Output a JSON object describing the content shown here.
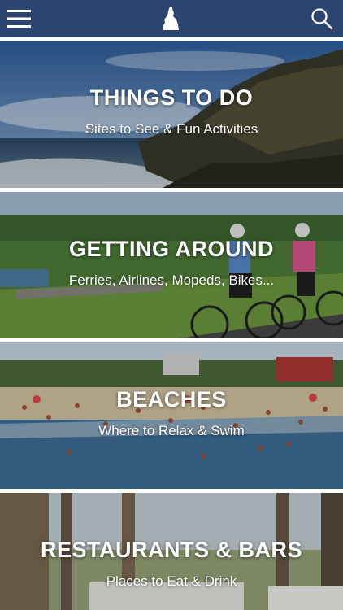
{
  "header": {
    "menu_icon": "hamburger-menu-icon",
    "logo_icon": "block-island-logo-icon",
    "search_icon": "magnifier-search-icon",
    "background_color": "#2c4470"
  },
  "tiles": [
    {
      "title": "THINGS TO DO",
      "subtitle": "Sites to See & Fun Activities"
    },
    {
      "title": "GETTING AROUND",
      "subtitle": "Ferries, Airlines, Mopeds, Bikes..."
    },
    {
      "title": "BEACHES",
      "subtitle": "Where to Relax & Swim"
    },
    {
      "title": "RESTAURANTS & BARS",
      "subtitle": "Places to Eat & Drink"
    }
  ]
}
